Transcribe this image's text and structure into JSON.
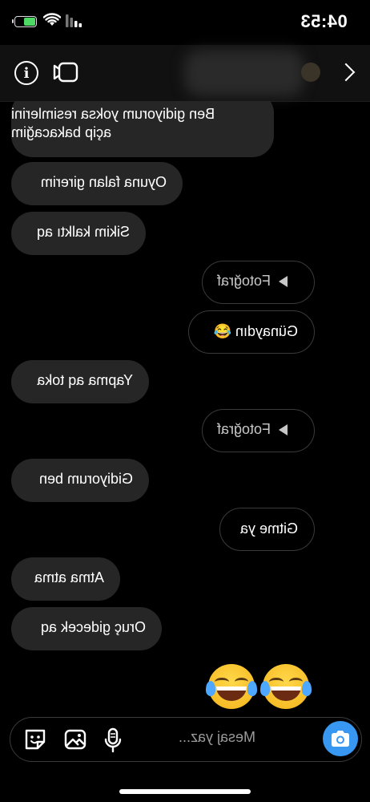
{
  "status_bar": {
    "time": "04:53"
  },
  "header": {
    "info_icon_label": "i"
  },
  "messages": [
    {
      "id": 1,
      "side": "received",
      "lines": [
        "Ben gidiyorum yoksa resimlerini",
        "açip bakacağim"
      ]
    },
    {
      "id": 2,
      "side": "received",
      "lines": [
        "Oyuna falan girerim"
      ]
    },
    {
      "id": 3,
      "side": "received",
      "lines": [
        "Sikim kalktı aq"
      ]
    },
    {
      "id": 4,
      "side": "sent",
      "type": "photo",
      "label": "Fotoğraf"
    },
    {
      "id": 5,
      "side": "sent",
      "lines": [
        "Günaydın 😂"
      ]
    },
    {
      "id": 6,
      "side": "received",
      "lines": [
        "Yapma aq toka"
      ]
    },
    {
      "id": 7,
      "side": "sent",
      "type": "photo",
      "label": "Fotoğraf"
    },
    {
      "id": 8,
      "side": "received",
      "lines": [
        "Gidiyorum ben"
      ]
    },
    {
      "id": 9,
      "side": "sent",
      "lines": [
        "Gitme ya"
      ]
    },
    {
      "id": 10,
      "side": "received",
      "lines": [
        "Atma atma"
      ]
    },
    {
      "id": 11,
      "side": "received",
      "lines": [
        "Oruç gidecek aq"
      ]
    },
    {
      "id": 12,
      "side": "sent",
      "type": "emoji",
      "count": 2,
      "emoji": "😂"
    }
  ],
  "composer": {
    "placeholder": "Mesaj yaz..."
  },
  "colors": {
    "accent": "#3897f0",
    "received_bubble": "#262626",
    "background": "#000000",
    "battery": "#4cd964"
  },
  "icons": [
    "battery-icon",
    "wifi-icon",
    "signal-icon",
    "info-icon",
    "video-call-icon",
    "back-chevron-icon",
    "camera-icon",
    "sticker-icon",
    "gallery-icon",
    "microphone-icon"
  ]
}
